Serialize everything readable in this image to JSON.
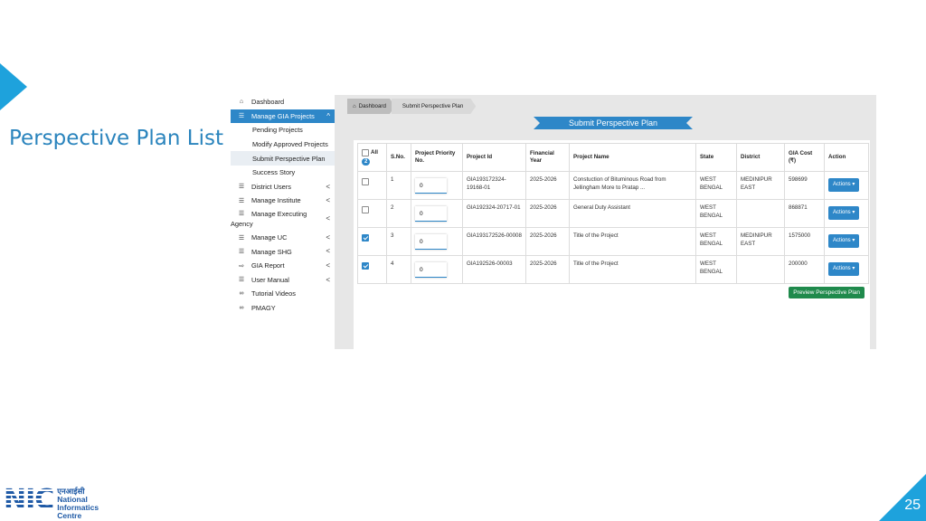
{
  "slide": {
    "title": "Perspective Plan List",
    "page_number": "25",
    "logo": {
      "mark": "NIC",
      "line1": "एनआईसी",
      "line2": "National",
      "line3": "Informatics",
      "line4": "Centre"
    }
  },
  "sidebar": {
    "items": [
      {
        "label": "Dashboard",
        "icon": "home-icon"
      },
      {
        "label": "Manage GIA Projects",
        "icon": "list-icon",
        "chevron": "^"
      },
      {
        "label": "Pending Projects"
      },
      {
        "label": "Modify Approved Projects"
      },
      {
        "label": "Submit Perspective Plan"
      },
      {
        "label": "Success Story"
      },
      {
        "label": "District Users",
        "icon": "list-icon",
        "chevron": "<"
      },
      {
        "label": "Manage Institute",
        "icon": "list-icon",
        "chevron": "<"
      },
      {
        "label": "Manage Executing",
        "label2": "Agency",
        "icon": "list-icon",
        "chevron": "<"
      },
      {
        "label": "Manage UC",
        "icon": "list-icon",
        "chevron": "<"
      },
      {
        "label": "Manage SHG",
        "icon": "list-icon",
        "chevron": "<"
      },
      {
        "label": "GIA Report",
        "icon": "sign-in-icon",
        "chevron": "<"
      },
      {
        "label": "User Manual",
        "icon": "list-icon",
        "chevron": "<"
      },
      {
        "label": "Tutorial Videos",
        "icon": "link-icon"
      },
      {
        "label": "PMAGY",
        "icon": "link-icon"
      }
    ]
  },
  "breadcrumb": {
    "home": "Dashboard",
    "current": "Submit Perspective Plan"
  },
  "page": {
    "banner": "Submit Perspective Plan",
    "preview_button": "Preview Perspective Plan"
  },
  "table": {
    "headers": {
      "all": "All",
      "all_count": "2",
      "sno": "S.No.",
      "priority": "Project Priority No.",
      "project_id": "Project Id",
      "fin_year": "Financial Year",
      "project_name": "Project Name",
      "state": "State",
      "district": "District",
      "gia_cost": "GIA Cost (₹)",
      "action": "Action"
    },
    "rows": [
      {
        "checked": false,
        "sno": "1",
        "priority": "0",
        "project_id": "GIA193172324-19168-01",
        "fin_year": "2025-2026",
        "project_name": "Constuction of Bituminous Road from Jellingham More to Pratap ...",
        "state": "WEST BENGAL",
        "district": "MEDINIPUR EAST",
        "gia_cost": "598699",
        "action": "Actions ▾"
      },
      {
        "checked": false,
        "sno": "2",
        "priority": "0",
        "project_id": "GIA192324-20717-01",
        "fin_year": "2025-2026",
        "project_name": "General Duty Assistant",
        "state": "WEST BENGAL",
        "district": "",
        "gia_cost": "868871",
        "action": "Actions ▾"
      },
      {
        "checked": true,
        "sno": "3",
        "priority": "0",
        "project_id": "GIA193172526-00008",
        "fin_year": "2025-2026",
        "project_name": "Title of the Project",
        "state": "WEST BENGAL",
        "district": "MEDINIPUR EAST",
        "gia_cost": "1575000",
        "action": "Actions ▾"
      },
      {
        "checked": true,
        "sno": "4",
        "priority": "0",
        "project_id": "GIA192526-00003",
        "fin_year": "2025-2026",
        "project_name": "Title of the Project",
        "state": "WEST BENGAL",
        "district": "",
        "gia_cost": "200000",
        "action": "Actions ▾"
      }
    ]
  },
  "colors": {
    "accent": "#2e87c8",
    "slide_accent": "#1ea2dc",
    "preview_button": "#1f8a4c"
  }
}
